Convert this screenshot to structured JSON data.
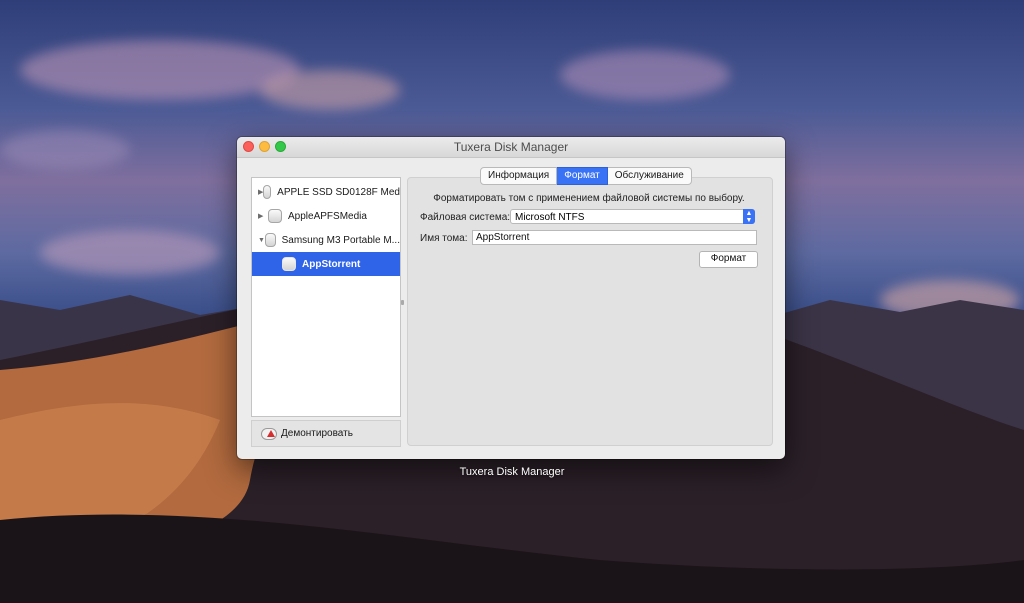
{
  "window": {
    "title": "Tuxera Disk Manager"
  },
  "sidebar": {
    "items": [
      {
        "label": "APPLE SSD SD0128F Med",
        "expander": "▶"
      },
      {
        "label": "AppleAPFSMedia",
        "expander": "▶"
      },
      {
        "label": "Samsung M3 Portable M...",
        "expander": "▼"
      },
      {
        "label": "AppStorrent",
        "expander": "",
        "selected": true
      }
    ],
    "unmount_label": "Демонтировать"
  },
  "tabs": [
    {
      "label": "Информация"
    },
    {
      "label": "Формат",
      "active": true
    },
    {
      "label": "Обслуживание"
    }
  ],
  "format": {
    "description": "Форматировать том с применением файловой системы по выбору.",
    "filesystem_label": "Файловая система:",
    "filesystem_value": "Microsoft NTFS",
    "volume_label": "Имя тома:",
    "volume_value": "AppStorrent",
    "button_label": "Формат"
  },
  "dock": {
    "app_label": "Tuxera Disk Manager"
  },
  "colors": {
    "accent": "#3a72f5",
    "selection": "#2f63e8"
  }
}
